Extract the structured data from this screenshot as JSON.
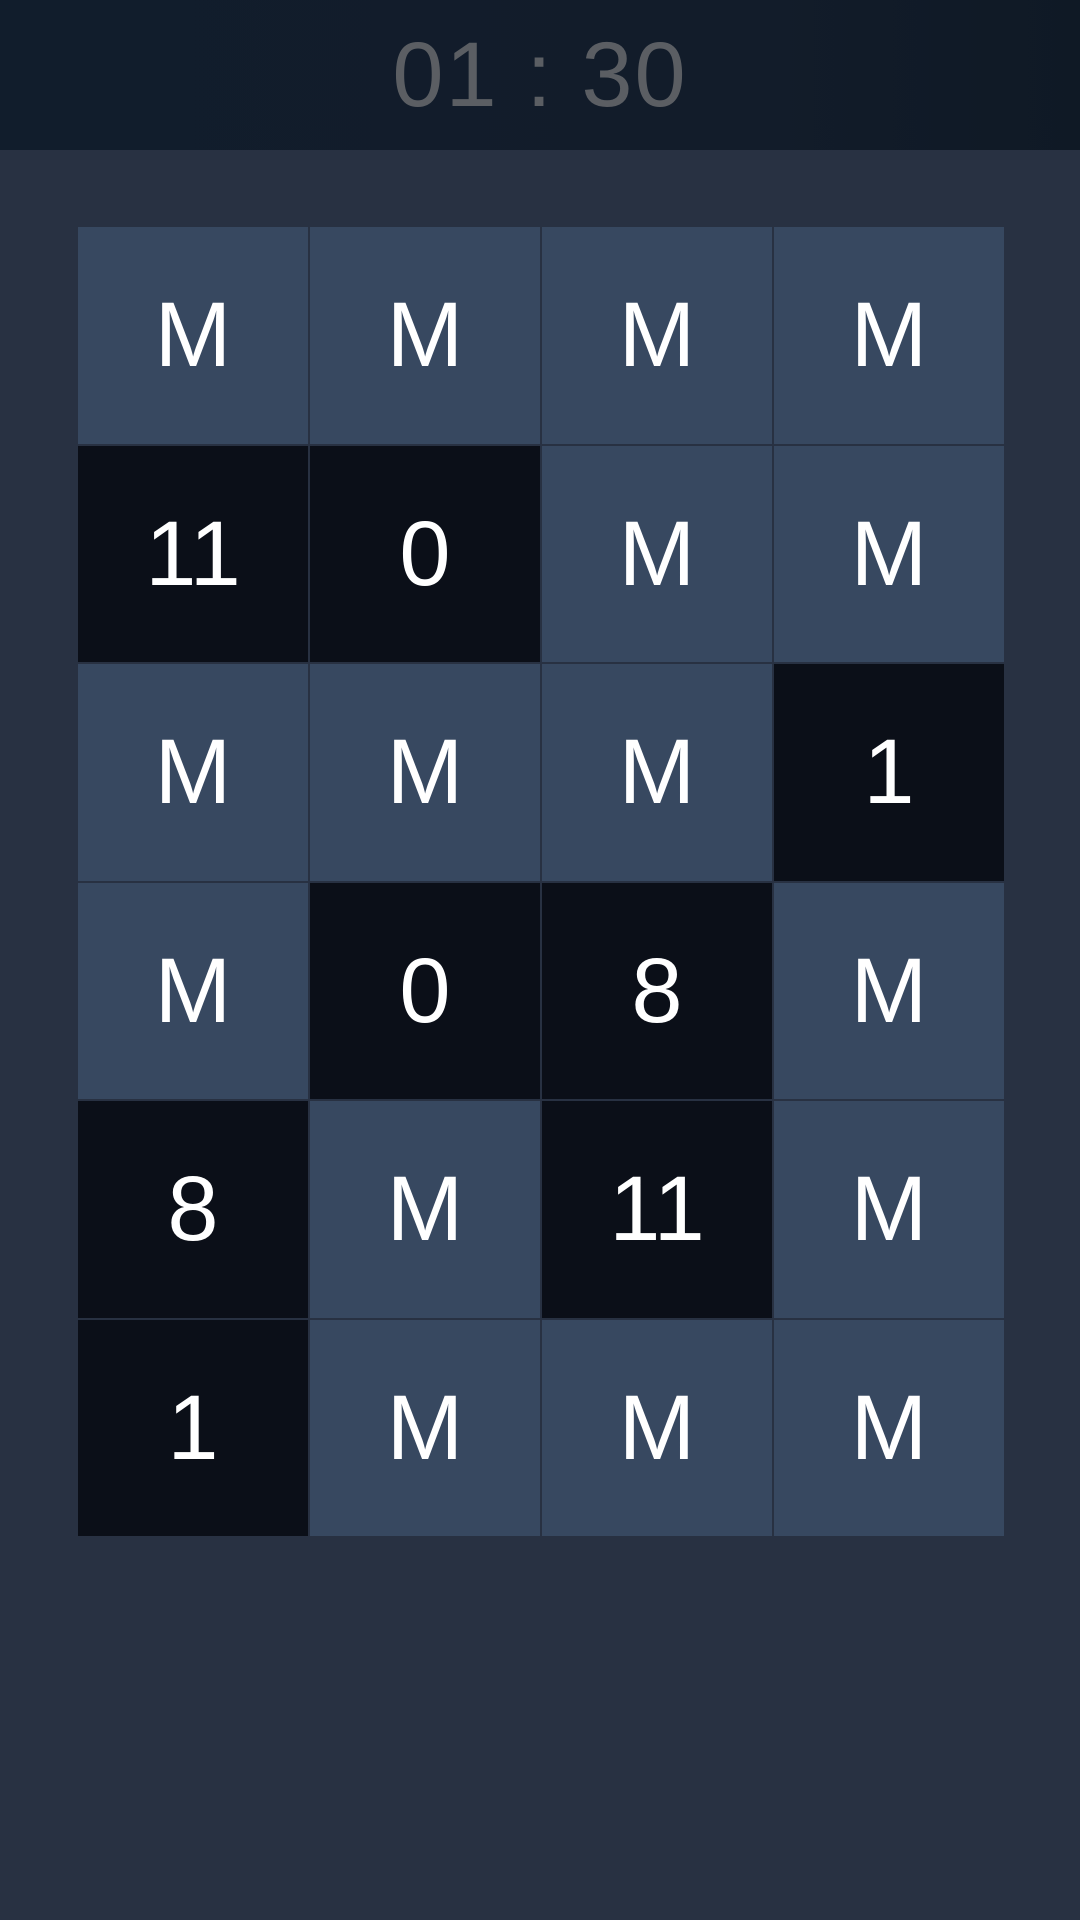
{
  "header": {
    "timer": "01 : 30"
  },
  "board": {
    "tiles": [
      {
        "label": "M",
        "state": "hidden"
      },
      {
        "label": "M",
        "state": "hidden"
      },
      {
        "label": "M",
        "state": "hidden"
      },
      {
        "label": "M",
        "state": "hidden"
      },
      {
        "label": "11",
        "state": "revealed"
      },
      {
        "label": "0",
        "state": "revealed"
      },
      {
        "label": "M",
        "state": "hidden"
      },
      {
        "label": "M",
        "state": "hidden"
      },
      {
        "label": "M",
        "state": "hidden"
      },
      {
        "label": "M",
        "state": "hidden"
      },
      {
        "label": "M",
        "state": "hidden"
      },
      {
        "label": "1",
        "state": "revealed"
      },
      {
        "label": "M",
        "state": "hidden"
      },
      {
        "label": "0",
        "state": "revealed"
      },
      {
        "label": "8",
        "state": "revealed"
      },
      {
        "label": "M",
        "state": "hidden"
      },
      {
        "label": "8",
        "state": "revealed"
      },
      {
        "label": "M",
        "state": "hidden"
      },
      {
        "label": "11",
        "state": "revealed"
      },
      {
        "label": "M",
        "state": "hidden"
      },
      {
        "label": "1",
        "state": "revealed"
      },
      {
        "label": "M",
        "state": "hidden"
      },
      {
        "label": "M",
        "state": "hidden"
      },
      {
        "label": "M",
        "state": "hidden"
      }
    ]
  },
  "colors": {
    "background": "#283142",
    "header": "#121c2a",
    "timer_text": "#5b5e63",
    "tile_hidden": "#374860",
    "tile_revealed": "#0b0f18",
    "tile_text": "#ffffff"
  }
}
